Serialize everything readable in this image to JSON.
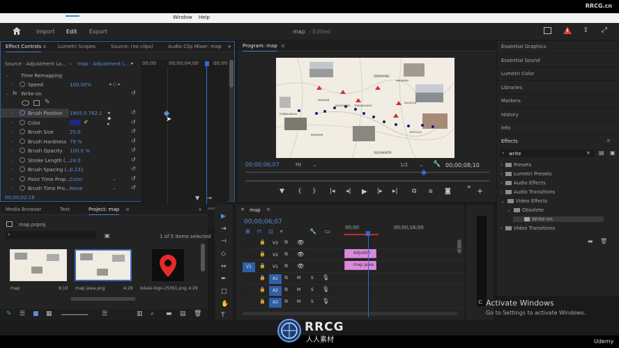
{
  "menubar": {
    "items": [
      "Window",
      "Help"
    ],
    "brand": "RRCG.cn"
  },
  "workspace": {
    "tabs": [
      "Import",
      "Edit",
      "Export"
    ],
    "active": "Edit",
    "project_title": "map",
    "status": "- Edited"
  },
  "effect_controls": {
    "tabs": [
      "Effect Controls",
      "Lumetri Scopes",
      "Source: (no clips)",
      "Audio Clip Mixer: map"
    ],
    "source_label": "Source · Adjustment La...",
    "sequence_label": "map · Adjustment L...",
    "ruler": [
      "00;00",
      "00;00;04;00",
      "00;00"
    ],
    "time_remapping": "Time Remapping",
    "speed_label": "Speed",
    "speed_value": "100.00%",
    "fx_label": "fx",
    "effect_name": "Write-on",
    "rows": [
      {
        "name": "Brush Position",
        "value": "1805.0   782.1"
      },
      {
        "name": "Color",
        "value": ""
      },
      {
        "name": "Brush Size",
        "value": "25.0"
      },
      {
        "name": "Brush Hardness",
        "value": "79 %"
      },
      {
        "name": "Brush Opacity",
        "value": "100.0 %"
      },
      {
        "name": "Stroke Length (...",
        "value": "24.0"
      },
      {
        "name": "Brush Spacing (...",
        "value": "0.231"
      },
      {
        "name": "Paint Time Prop...",
        "value": "Color"
      },
      {
        "name": "Brush Time Pro...",
        "value": "None"
      }
    ],
    "timecode": "00;00;02;16",
    "brush_color": "#1a2a80"
  },
  "program": {
    "title": "Program: map",
    "timecode_left": "00;00;06;07",
    "fit": "Fit",
    "resolution": "1/2",
    "timecode_right": "00;00;08;10",
    "map_labels": [
      "SEMARANG",
      "PURBALINGGA",
      "WONOSOBO",
      "TEMANGGUNG",
      "SALATIGA",
      "BOYOLALI",
      "KEBUMEN",
      "YOGYAKARTA",
      "UNGARAN",
      "PARAKAN"
    ]
  },
  "right_panel": {
    "items": [
      "Essential Graphics",
      "Essential Sound",
      "Lumetri Color",
      "Libraries",
      "Markers",
      "History",
      "Info"
    ]
  },
  "effects": {
    "title": "Effects",
    "search": "write",
    "tree": [
      {
        "label": "Presets",
        "level": 0
      },
      {
        "label": "Lumetri Presets",
        "level": 0
      },
      {
        "label": "Audio Effects",
        "level": 0
      },
      {
        "label": "Audio Transitions",
        "level": 0
      },
      {
        "label": "Video Effects",
        "level": 0
      },
      {
        "label": "Obsolete",
        "level": 1
      },
      {
        "label": "Write-on",
        "level": 2
      },
      {
        "label": "Video Transitions",
        "level": 0
      }
    ]
  },
  "project": {
    "tabs": [
      "Media Browser",
      "Text",
      "Project: map"
    ],
    "file": "map.prproj",
    "selection": "1 of 5 items selected",
    "items": [
      {
        "name": "map",
        "duration": "8;10"
      },
      {
        "name": "map jawa.png",
        "duration": "4;29"
      },
      {
        "name": "lokasi-logo-25361.png",
        "duration": "4;29"
      }
    ]
  },
  "timeline": {
    "title": "map",
    "timecode": "00;00;06;07",
    "ruler": [
      "00;00",
      "00;00;16;00"
    ],
    "tracks": [
      {
        "id": "V3",
        "src": ""
      },
      {
        "id": "V2",
        "src": ""
      },
      {
        "id": "V1",
        "src": "V1"
      },
      {
        "id": "A1",
        "src": ""
      },
      {
        "id": "A2",
        "src": ""
      },
      {
        "id": "A3",
        "src": ""
      }
    ],
    "clips": [
      "Adjustm",
      "map jawa"
    ],
    "audio_btns": [
      "M",
      "S"
    ]
  },
  "activation": {
    "title": "Activate Windows",
    "subtitle": "Go to Settings to activate Windows."
  },
  "watermark": {
    "logo": "RRCG",
    "sub": "人人素材",
    "udemy": "Udemy"
  }
}
